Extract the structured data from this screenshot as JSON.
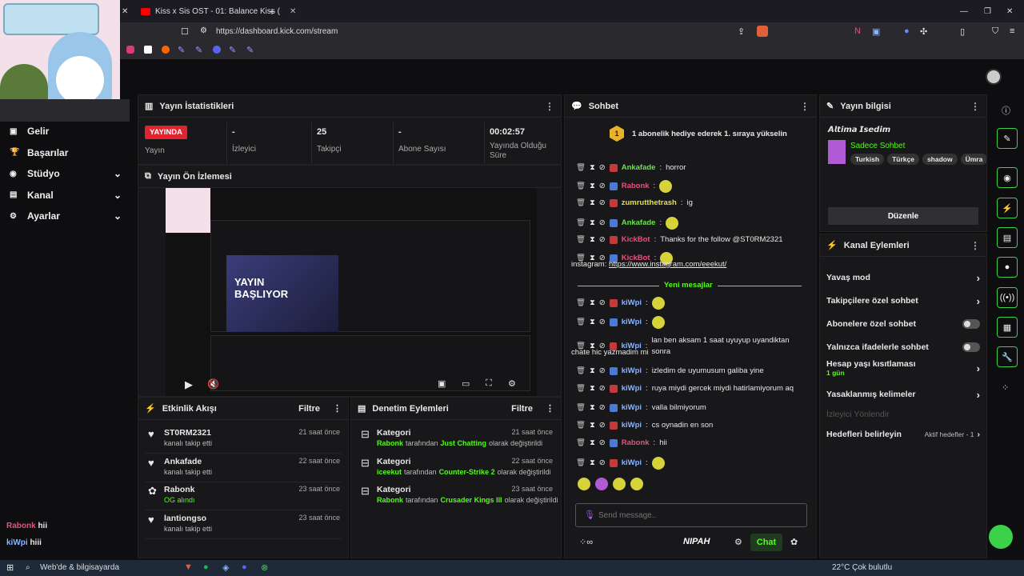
{
  "browser": {
    "tab_title": "Kiss x Sis OST - 01: Balance Kiss (",
    "url": "https://dashboard.kick.com/stream"
  },
  "sidebar": {
    "items": [
      {
        "label": "Gelir",
        "icon": "dollar-icon"
      },
      {
        "label": "Başarılar",
        "icon": "trophy-icon"
      },
      {
        "label": "Stüdyo",
        "icon": "studio-icon"
      },
      {
        "label": "Kanal",
        "icon": "channel-icon"
      },
      {
        "label": "Ayarlar",
        "icon": "gear-icon"
      }
    ],
    "chat_overlay": [
      {
        "user": "Rabonk",
        "msg": "hii",
        "color": "#e8507a"
      },
      {
        "user": "kiWpi",
        "msg": "hiii",
        "color": "#8ab4ff"
      }
    ]
  },
  "stats": {
    "title": "Yayın İstatistikleri",
    "live_label": "YAYINDA",
    "status_label": "Yayın",
    "items": [
      {
        "value": "-",
        "label": "İzleyici"
      },
      {
        "value": "25",
        "label": "Takipçi"
      },
      {
        "value": "-",
        "label": "Abone Sayısı"
      },
      {
        "value": "00:02:57",
        "label": "Yayında Olduğu Süre"
      }
    ]
  },
  "preview": {
    "title": "Yayın Ön İzlemesi",
    "overlay_text": "YAYIN BAŞLIYOR"
  },
  "activity": {
    "title": "Etkinlik Akışı",
    "filter": "Filtre",
    "rows": [
      {
        "name": "ST0RM2321",
        "sub": "kanalı takip etti",
        "time": "21 saat önce",
        "icon": "heart-icon"
      },
      {
        "name": "Ankafade",
        "sub": "kanalı takip etti",
        "time": "22 saat önce",
        "icon": "heart-icon"
      },
      {
        "name": "Rabonk",
        "sub": "OG alındı",
        "time": "23 saat önce",
        "icon": "badge-icon"
      },
      {
        "name": "lantiongso",
        "sub": "kanalı takip etti",
        "time": "23 saat önce",
        "icon": "heart-icon"
      }
    ]
  },
  "moderation": {
    "title": "Denetim Eylemleri",
    "filter": "Filtre",
    "rows": [
      {
        "name": "Kategori",
        "actor": "Rabonk",
        "mid": "tarafından",
        "target": "Just Chatting",
        "end": "olarak değiştirildi",
        "time": "21 saat önce"
      },
      {
        "name": "Kategori",
        "actor": "iceekut",
        "mid": "tarafından",
        "target": "Counter-Strike 2",
        "end": "olarak değiştirildi",
        "time": "22 saat önce"
      },
      {
        "name": "Kategori",
        "actor": "Rabonk",
        "mid": "tarafından",
        "target": "Crusader Kings III",
        "end": "olarak değiştirildi",
        "time": "23 saat önce"
      }
    ]
  },
  "chat": {
    "title": "Sohbet",
    "gift_banner": "1 abonelik hediye ederek 1. sıraya yükselin",
    "gift_count": "1",
    "new_messages": "Yeni mesajlar",
    "placeholder": "Send message..",
    "send_label": "Chat",
    "nipah": "NIPAH",
    "messages": [
      {
        "user": "Ankafade",
        "text": "horror",
        "color": "#69e34a"
      },
      {
        "user": "Rabonk",
        "text": "",
        "color": "#e8507a"
      },
      {
        "user": "zumrutthetrash",
        "text": "ig",
        "color": "#e3e04a"
      },
      {
        "user": "Ankafade",
        "text": "",
        "color": "#69e34a"
      },
      {
        "user": "KickBot",
        "text": "Thanks for the follow @ST0RM2321",
        "color": "#e8507a"
      },
      {
        "user": "KickBot",
        "text": "",
        "color": "#e8507a"
      },
      {
        "user": "kiWpi",
        "text": "",
        "color": "#8ab4ff"
      },
      {
        "user": "kiWpi",
        "text": "",
        "color": "#8ab4ff"
      },
      {
        "user": "kiWpi",
        "text": "lan ben aksam 1 saat uyuyup uyandiktan sonra",
        "color": "#8ab4ff"
      },
      {
        "user": "kiWpi",
        "text": "izledim de uyumusum galiba yine",
        "color": "#8ab4ff"
      },
      {
        "user": "kiWpi",
        "text": "ruya miydi gercek miydi hatirlamiyorum aq",
        "color": "#8ab4ff"
      },
      {
        "user": "kiWpi",
        "text": "valla bilmiyorum",
        "color": "#8ab4ff"
      },
      {
        "user": "kiWpi",
        "text": "cs oynadin en son",
        "color": "#8ab4ff"
      },
      {
        "user": "Rabonk",
        "text": "hii",
        "color": "#e8507a"
      },
      {
        "user": "kiWpi",
        "text": "",
        "color": "#8ab4ff"
      }
    ],
    "instagram_prefix": "instagram:",
    "instagram_link": "https://www.instagram.com/eeekut/",
    "wrap_text": "chate hic yazmadim mi"
  },
  "stream_info": {
    "title": "Yayın bilgisi",
    "stream_title": "𝘼𝙡𝙩𝙞𝙢𝙖 𝙄𝙨𝙚𝙙𝙞𝙢",
    "category": "Sadece Sohbet",
    "tags": [
      "Turkish",
      "Türkçe",
      "shadow",
      "Ümra"
    ],
    "edit": "Düzenle"
  },
  "channel_actions": {
    "title": "Kanal Eylemleri",
    "rows": [
      {
        "label": "Yavaş mod",
        "kind": "chevron"
      },
      {
        "label": "Takipçilere özel sohbet",
        "kind": "chevron"
      },
      {
        "label": "Abonelere özel sohbet",
        "kind": "toggle"
      },
      {
        "label": "Yalnızca ifadelerle sohbet",
        "kind": "toggle"
      },
      {
        "label": "Hesap yaşı kısıtlaması",
        "kind": "chevron",
        "sub": "1 gün"
      },
      {
        "label": "Yasaklanmış kelimeler",
        "kind": "chevron"
      },
      {
        "label": "İzleyici Yönlendir",
        "kind": "disabled"
      },
      {
        "label": "Hedefleri belirleyin",
        "kind": "goals",
        "sub": "Aktif hedefler - 1"
      }
    ]
  },
  "taskbar": {
    "search": "Web'de & bilgisayarda",
    "weather": "22°C  Çok bulutlu"
  },
  "colors": {
    "accent": "#53fc18",
    "live": "#e0242f"
  }
}
